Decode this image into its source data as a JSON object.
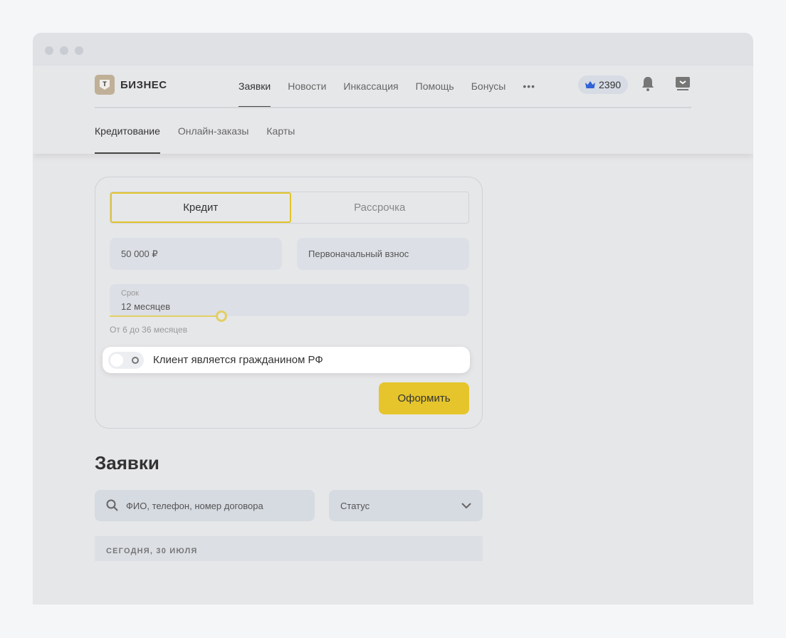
{
  "header": {
    "logo_letter": "Т",
    "logo_text": "БИЗНЕС",
    "nav": [
      "Заявки",
      "Новости",
      "Инкассация",
      "Помощь",
      "Бонусы"
    ],
    "more": "•••",
    "bonus_points": "2390",
    "subnav": [
      "Кредитование",
      "Онлайн-заказы",
      "Карты"
    ]
  },
  "form": {
    "tabs": [
      "Кредит",
      "Рассрочка"
    ],
    "amount": "50 000 ₽",
    "down_payment_placeholder": "Первоначальный взнос",
    "term_label": "Срок",
    "term_value": "12 месяцев",
    "term_months": 12,
    "term_min": 6,
    "term_max": 36,
    "term_hint": "От 6 до 36 месяцев",
    "citizen_toggle": "Клиент является гражданином РФ",
    "citizen_on": false,
    "submit": "Оформить"
  },
  "requests": {
    "title": "Заявки",
    "search_placeholder": "ФИО, телефон, номер договора",
    "status_label": "Статус",
    "date_group": "СЕГОДНЯ, 30 ИЮЛЯ"
  },
  "colors": {
    "accent": "#e5c52b",
    "bonus_crown": "#2f63d6"
  }
}
